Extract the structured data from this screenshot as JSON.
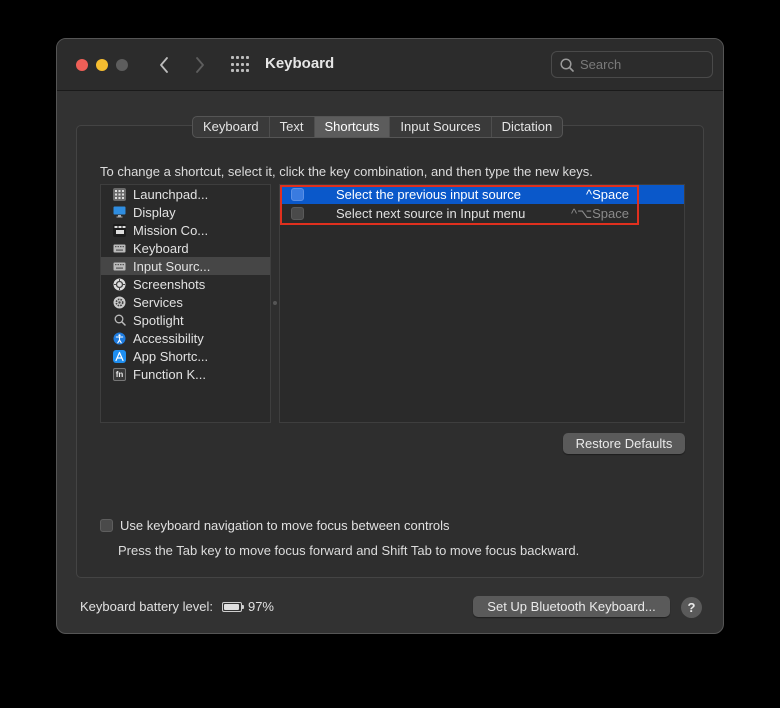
{
  "window": {
    "title": "Keyboard",
    "search_placeholder": "Search"
  },
  "tabs": [
    {
      "label": "Keyboard",
      "active": false
    },
    {
      "label": "Text",
      "active": false
    },
    {
      "label": "Shortcuts",
      "active": true
    },
    {
      "label": "Input Sources",
      "active": false
    },
    {
      "label": "Dictation",
      "active": false
    }
  ],
  "instruction": "To change a shortcut, select it, click the key combination, and then type the new keys.",
  "categories": [
    {
      "label": "Launchpad...",
      "icon": "launchpad-icon",
      "selected": false
    },
    {
      "label": "Display",
      "icon": "display-icon",
      "selected": false
    },
    {
      "label": "Mission Co...",
      "icon": "mission-control-icon",
      "selected": false
    },
    {
      "label": "Keyboard",
      "icon": "keyboard-icon",
      "selected": false
    },
    {
      "label": "Input Sourc...",
      "icon": "input-sources-icon",
      "selected": true
    },
    {
      "label": "Screenshots",
      "icon": "screenshots-icon",
      "selected": false
    },
    {
      "label": "Services",
      "icon": "services-gear-icon",
      "selected": false
    },
    {
      "label": "Spotlight",
      "icon": "spotlight-search-icon",
      "selected": false
    },
    {
      "label": "Accessibility",
      "icon": "accessibility-icon",
      "selected": false
    },
    {
      "label": "App Shortc...",
      "icon": "app-shortcuts-icon",
      "selected": false
    },
    {
      "label": "Function K...",
      "icon": "fn-key-icon",
      "selected": false
    }
  ],
  "shortcuts": [
    {
      "label": "Select the previous input source",
      "key": "^Space",
      "checked": false,
      "selected": true
    },
    {
      "label": "Select next source in Input menu",
      "key": "^⌥Space",
      "checked": false,
      "selected": false
    }
  ],
  "buttons": {
    "restore_defaults": "Restore Defaults",
    "setup_bluetooth": "Set Up Bluetooth Keyboard...",
    "help": "?"
  },
  "keyboard_navigation": {
    "label": "Use keyboard navigation to move focus between controls",
    "checked": false,
    "help_text": "Press the Tab key to move focus forward and Shift Tab to move focus backward."
  },
  "battery": {
    "label": "Keyboard battery level:",
    "level_text": "97%",
    "level": 0.97
  },
  "colors": {
    "selection": "#0a58ca",
    "highlight_box": "#e0301e",
    "traffic_close": "#ee5f57",
    "traffic_minimize": "#f5bd30"
  }
}
